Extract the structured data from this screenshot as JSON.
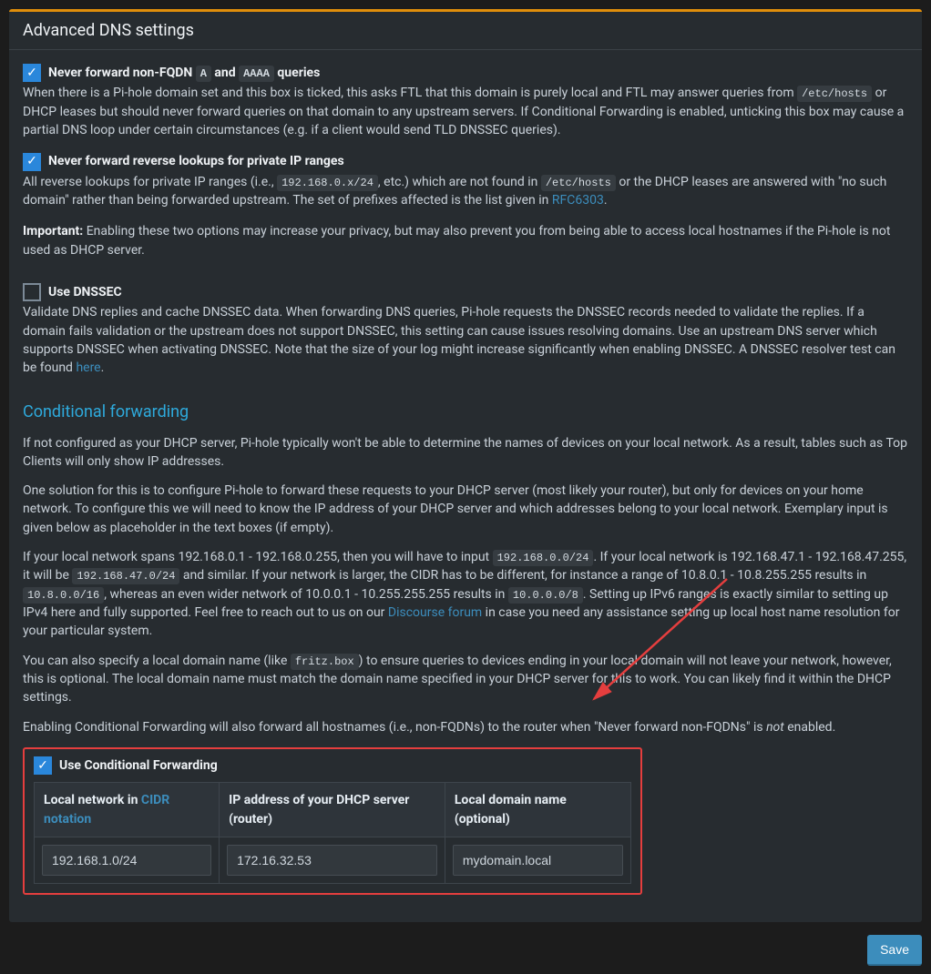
{
  "header": {
    "title": "Advanced DNS settings"
  },
  "opt1": {
    "label_pre": "Never forward non-FQDN ",
    "code1": "A",
    "mid": " and ",
    "code2": "AAAA",
    "label_post": " queries",
    "desc_pre": "When there is a Pi-hole domain set and this box is ticked, this asks FTL that this domain is purely local and FTL may answer queries from ",
    "code3": "/etc/hosts",
    "desc_post": " or DHCP leases but should never forward queries on that domain to any upstream servers. If Conditional Forwarding is enabled, unticking this box may cause a partial DNS loop under certain circumstances (e.g. if a client would send TLD DNSSEC queries)."
  },
  "opt2": {
    "label": "Never forward reverse lookups for private IP ranges",
    "d1": "All reverse lookups for private IP ranges (i.e., ",
    "c1": "192.168.0.x/24",
    "d2": ", etc.) which are not found in ",
    "c2": "/etc/hosts",
    "d3": " or the DHCP leases are answered with \"no such domain\" rather than being forwarded upstream. The set of prefixes affected is the list given in ",
    "link": "RFC6303",
    "d4": "."
  },
  "important": {
    "label": "Important:",
    "text": " Enabling these two options may increase your privacy, but may also prevent you from being able to access local hostnames if the Pi-hole is not used as DHCP server."
  },
  "opt3": {
    "label": "Use DNSSEC",
    "d1": "Validate DNS replies and cache DNSSEC data. When forwarding DNS queries, Pi-hole requests the DNSSEC records needed to validate the replies. If a domain fails validation or the upstream does not support DNSSEC, this setting can cause issues resolving domains. Use an upstream DNS server which supports DNSSEC when activating DNSSEC. Note that the size of your log might increase significantly when enabling DNSSEC. A DNSSEC resolver test can be found ",
    "link": "here",
    "d2": "."
  },
  "cf_heading": "Conditional forwarding",
  "cf": {
    "p1": "If not configured as your DHCP server, Pi-hole typically won't be able to determine the names of devices on your local network. As a result, tables such as Top Clients will only show IP addresses.",
    "p2": "One solution for this is to configure Pi-hole to forward these requests to your DHCP server (most likely your router), but only for devices on your home network. To configure this we will need to know the IP address of your DHCP server and which addresses belong to your local network. Exemplary input is given below as placeholder in the text boxes (if empty).",
    "p3a": "If your local network spans 192.168.0.1 - 192.168.0.255, then you will have to input ",
    "c1": "192.168.0.0/24",
    "p3b": ". If your local network is 192.168.47.1 - 192.168.47.255, it will be ",
    "c2": "192.168.47.0/24",
    "p3c": " and similar. If your network is larger, the CIDR has to be different, for instance a range of 10.8.0.1 - 10.8.255.255 results in ",
    "c3": "10.8.0.0/16",
    "p3d": ", whereas an even wider network of 10.0.0.1 - 10.255.255.255 results in ",
    "c4": "10.0.0.0/8",
    "p3e": ". Setting up IPv6 ranges is exactly similar to setting up IPv4 here and fully supported. Feel free to reach out to us on our ",
    "link": "Discourse forum",
    "p3f": " in case you need any assistance setting up local host name resolution for your particular system.",
    "p4a": "You can also specify a local domain name (like ",
    "c5": "fritz.box",
    "p4b": ") to ensure queries to devices ending in your local domain will not leave your network, however, this is optional. The local domain name must match the domain name specified in your DHCP server for this to work. You can likely find it within the DHCP settings.",
    "p5a": "Enabling Conditional Forwarding will also forward all hostnames (i.e., non-FQDNs) to the router when \"Never forward non-FQDNs\" is ",
    "p5em": "not",
    "p5b": " enabled."
  },
  "use_cf_label": "Use Conditional Forwarding",
  "table": {
    "h1a": "Local network in ",
    "h1link": "CIDR notation",
    "h2": "IP address of your DHCP server (router)",
    "h3": "Local domain name (optional)",
    "v1": "192.168.1.0/24",
    "v2": "172.16.32.53",
    "v3": "mydomain.local"
  },
  "save": "Save"
}
